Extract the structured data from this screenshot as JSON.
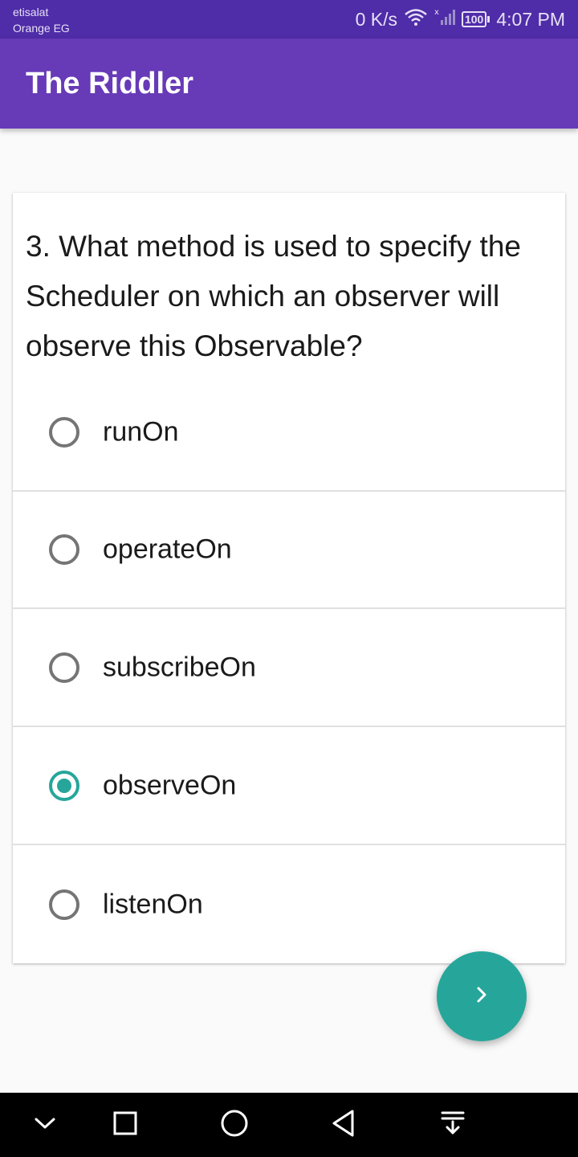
{
  "status_bar": {
    "carrier_line1": "etisalat",
    "carrier_line2": "Orange EG",
    "net_speed": "0 K/s",
    "battery": "100",
    "time": "4:07 PM",
    "icons": [
      "wifi-icon",
      "signal-icon",
      "battery-icon"
    ]
  },
  "app_bar": {
    "title": "The Riddler"
  },
  "quiz": {
    "question": "3. What method is used to specify the Scheduler on which an observer will observe this Observable?",
    "options": [
      {
        "label": "runOn",
        "selected": false
      },
      {
        "label": "operateOn",
        "selected": false
      },
      {
        "label": "subscribeOn",
        "selected": false
      },
      {
        "label": "observeOn",
        "selected": true
      },
      {
        "label": "listenOn",
        "selected": false
      }
    ]
  },
  "fab": {
    "icon": "chevron-right-icon"
  },
  "nav_bar": {
    "buttons": [
      "collapse-icon",
      "recents-icon",
      "home-icon",
      "back-icon",
      "notifications-pull-icon"
    ]
  },
  "colors": {
    "status_bar": "#4f2ca8",
    "app_bar": "#673ab7",
    "accent": "#26a69a",
    "background": "#fafafa"
  }
}
